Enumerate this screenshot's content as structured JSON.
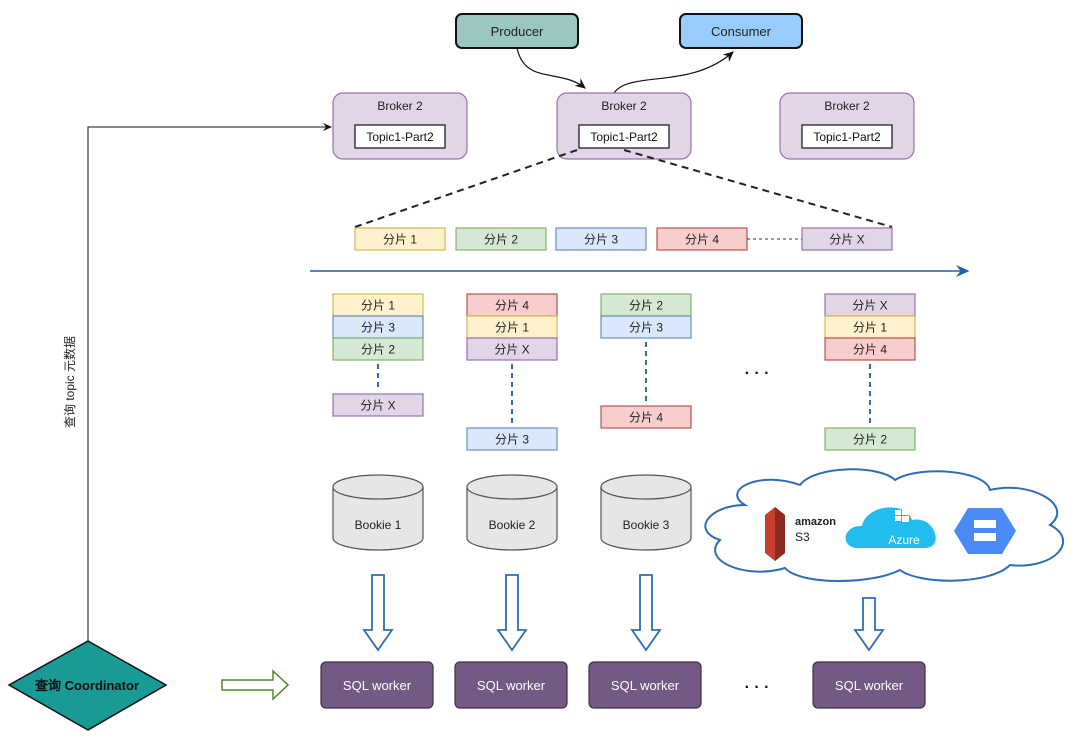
{
  "producer": {
    "label": "Producer",
    "color": "#9ac7bf"
  },
  "consumer": {
    "label": "Consumer",
    "color": "#99ccff"
  },
  "brokers": [
    {
      "title": "Broker 2",
      "topic": "Topic1-Part2"
    },
    {
      "title": "Broker 2",
      "topic": "Topic1-Part2"
    },
    {
      "title": "Broker 2",
      "topic": "Topic1-Part2"
    }
  ],
  "shard_colors": {
    "1": {
      "fill": "#fff2cc",
      "stroke": "#d6b656"
    },
    "2": {
      "fill": "#d5e8d4",
      "stroke": "#82b366"
    },
    "3": {
      "fill": "#dae8fc",
      "stroke": "#6c8ebf"
    },
    "4": {
      "fill": "#f8cecc",
      "stroke": "#b85450"
    },
    "X": {
      "fill": "#e1d5e7",
      "stroke": "#9673a6"
    }
  },
  "shard_row": [
    {
      "id": "1",
      "label": "分片 1"
    },
    {
      "id": "2",
      "label": "分片 2"
    },
    {
      "id": "3",
      "label": "分片 3"
    },
    {
      "id": "4",
      "label": "分片 4"
    },
    {
      "id": "X",
      "label": "分片 X"
    }
  ],
  "bookie_columns": [
    {
      "top": [
        {
          "id": "1",
          "label": "分片 1"
        },
        {
          "id": "3",
          "label": "分片 3"
        },
        {
          "id": "2",
          "label": "分片 2"
        }
      ],
      "bottom": {
        "id": "X",
        "label": "分片 X"
      }
    },
    {
      "top": [
        {
          "id": "4",
          "label": "分片 4"
        },
        {
          "id": "1",
          "label": "分片 1"
        },
        {
          "id": "X",
          "label": "分片 X"
        }
      ],
      "bottom": {
        "id": "3",
        "label": "分片 3"
      }
    },
    {
      "top": [
        {
          "id": "2",
          "label": "分片 2"
        },
        {
          "id": "3",
          "label": "分片 3"
        }
      ],
      "bottom": {
        "id": "4",
        "label": "分片 4"
      }
    },
    {
      "top": [
        {
          "id": "X",
          "label": "分片 X"
        },
        {
          "id": "1",
          "label": "分片 1"
        },
        {
          "id": "4",
          "label": "分片 4"
        }
      ],
      "bottom": {
        "id": "2",
        "label": "分片 2"
      }
    }
  ],
  "ellipsis": "· · ·",
  "bookies": [
    "Bookie 1",
    "Bookie 2",
    "Bookie 3"
  ],
  "cloud": {
    "s3_brand": "amazon",
    "s3_label": "S3",
    "azure_label": "Azure"
  },
  "sql_workers": [
    "SQL worker",
    "SQL worker",
    "SQL worker",
    "SQL worker"
  ],
  "coordinator": {
    "label": "查询 Coordinator",
    "color": "#1a9a94"
  },
  "metadata_edge_label": "查询 topic 元数据",
  "accent_colors": {
    "timeline": "#1f5fa8",
    "sql_worker": "#735a85",
    "down_arrow": "#2e6db4",
    "right_arrow": "#4d8a2a"
  }
}
